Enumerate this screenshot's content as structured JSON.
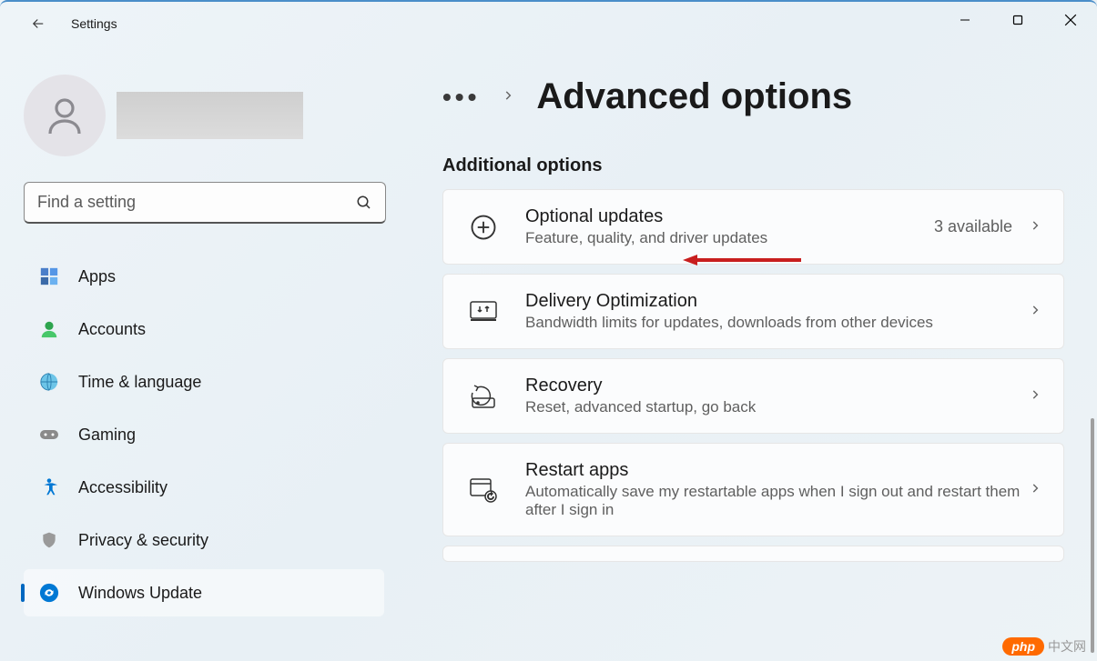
{
  "app": {
    "title": "Settings"
  },
  "search": {
    "placeholder": "Find a setting"
  },
  "nav": {
    "apps": "Apps",
    "accounts": "Accounts",
    "time_language": "Time & language",
    "gaming": "Gaming",
    "accessibility": "Accessibility",
    "privacy_security": "Privacy & security",
    "windows_update": "Windows Update"
  },
  "breadcrumb": {
    "title": "Advanced options"
  },
  "section": {
    "additional_options": "Additional options"
  },
  "cards": {
    "optional_updates": {
      "title": "Optional updates",
      "subtitle": "Feature, quality, and driver updates",
      "meta": "3 available"
    },
    "delivery_optimization": {
      "title": "Delivery Optimization",
      "subtitle": "Bandwidth limits for updates, downloads from other devices"
    },
    "recovery": {
      "title": "Recovery",
      "subtitle": "Reset, advanced startup, go back"
    },
    "restart_apps": {
      "title": "Restart apps",
      "subtitle": "Automatically save my restartable apps when I sign out and restart them after I sign in"
    }
  },
  "watermark": {
    "badge": "php",
    "text": "中文网"
  }
}
